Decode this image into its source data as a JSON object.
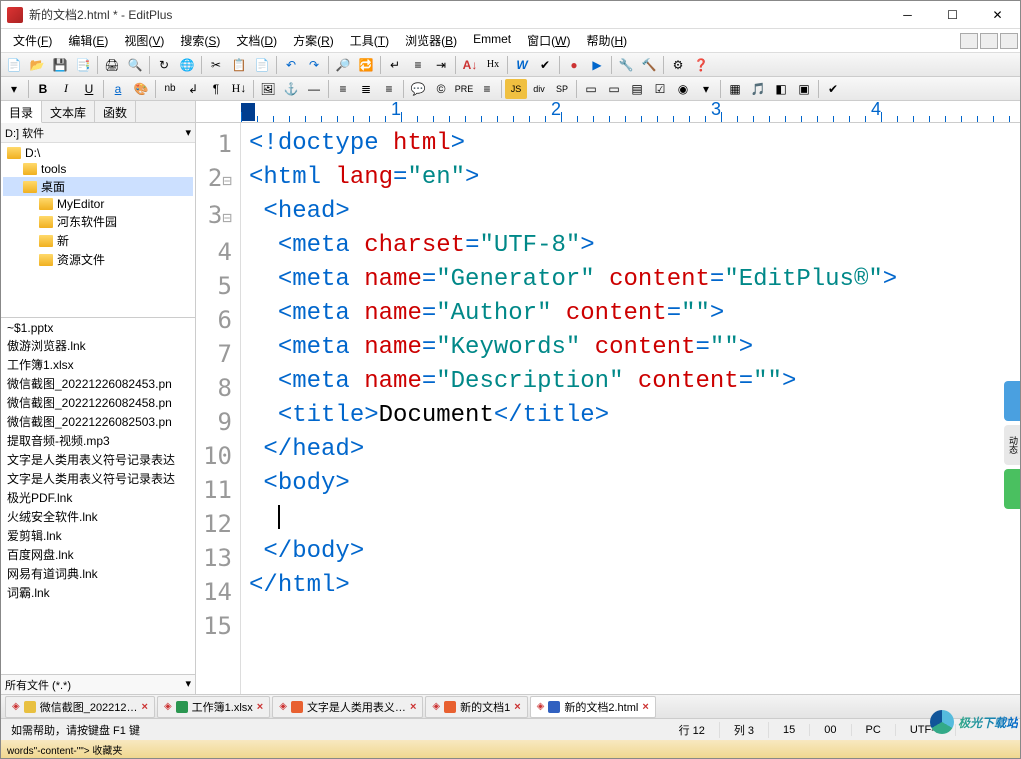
{
  "title": "新的文档2.html * - EditPlus",
  "menus": [
    "文件(F)",
    "编辑(E)",
    "视图(V)",
    "搜索(S)",
    "文档(D)",
    "方案(R)",
    "工具(T)",
    "浏览器(B)",
    "Emmet",
    "窗口(W)",
    "帮助(H)"
  ],
  "sidebar": {
    "tabs": [
      "目录",
      "文本库",
      "函数"
    ],
    "drive": "D:] 软件",
    "tree": [
      {
        "label": "D:\\",
        "indent": 0,
        "sel": false
      },
      {
        "label": "tools",
        "indent": 1,
        "sel": false
      },
      {
        "label": "桌面",
        "indent": 1,
        "sel": true
      },
      {
        "label": "MyEditor",
        "indent": 2,
        "sel": false
      },
      {
        "label": "河东软件园",
        "indent": 2,
        "sel": false
      },
      {
        "label": "新",
        "indent": 2,
        "sel": false
      },
      {
        "label": "资源文件",
        "indent": 2,
        "sel": false
      }
    ],
    "files": [
      "~$1.pptx",
      "傲游浏览器.lnk",
      "工作簿1.xlsx",
      "微信截图_20221226082453.pn",
      "微信截图_20221226082458.pn",
      "微信截图_20221226082503.pn",
      "提取音频-视频.mp3",
      "文字是人类用表义符号记录表达",
      "文字是人类用表义符号记录表达",
      "极光PDF.lnk",
      "火绒安全软件.lnk",
      "爱剪辑.lnk",
      "百度网盘.lnk",
      "网易有道词典.lnk",
      "词霸.lnk"
    ],
    "filter": "所有文件 (*.*)"
  },
  "code_lines": [
    {
      "n": 1,
      "fold": "",
      "html": "<span class='t-punct'>&lt;!</span><span class='t-tag'>doctype</span> <span class='t-attr'>html</span><span class='t-punct'>&gt;</span>"
    },
    {
      "n": 2,
      "fold": "⊟",
      "html": "<span class='t-punct'>&lt;</span><span class='t-tag'>html</span> <span class='t-attr'>lang</span><span class='t-punct'>=</span><span class='t-str'>\"en\"</span><span class='t-punct'>&gt;</span>"
    },
    {
      "n": 3,
      "fold": "⊟",
      "html": " <span class='t-punct'>&lt;</span><span class='t-tag'>head</span><span class='t-punct'>&gt;</span>"
    },
    {
      "n": 4,
      "fold": "",
      "html": "  <span class='t-punct'>&lt;</span><span class='t-tag'>meta</span> <span class='t-attr'>charset</span><span class='t-punct'>=</span><span class='t-str'>\"UTF-8\"</span><span class='t-punct'>&gt;</span>"
    },
    {
      "n": 5,
      "fold": "",
      "html": "  <span class='t-punct'>&lt;</span><span class='t-tag'>meta</span> <span class='t-attr'>name</span><span class='t-punct'>=</span><span class='t-str'>\"Generator\"</span> <span class='t-attr'>content</span><span class='t-punct'>=</span><span class='t-str'>\"EditPlus®\"</span><span class='t-punct'>&gt;</span>"
    },
    {
      "n": 6,
      "fold": "",
      "html": "  <span class='t-punct'>&lt;</span><span class='t-tag'>meta</span> <span class='t-attr'>name</span><span class='t-punct'>=</span><span class='t-str'>\"Author\"</span> <span class='t-attr'>content</span><span class='t-punct'>=</span><span class='t-str'>\"\"</span><span class='t-punct'>&gt;</span>"
    },
    {
      "n": 7,
      "fold": "",
      "html": "  <span class='t-punct'>&lt;</span><span class='t-tag'>meta</span> <span class='t-attr'>name</span><span class='t-punct'>=</span><span class='t-str'>\"Keywords\"</span> <span class='t-attr'>content</span><span class='t-punct'>=</span><span class='t-str'>\"\"</span><span class='t-punct'>&gt;</span>"
    },
    {
      "n": 8,
      "fold": "",
      "html": "  <span class='t-punct'>&lt;</span><span class='t-tag'>meta</span> <span class='t-attr'>name</span><span class='t-punct'>=</span><span class='t-str'>\"Description\"</span> <span class='t-attr'>content</span><span class='t-punct'>=</span><span class='t-str'>\"\"</span><span class='t-punct'>&gt;</span>"
    },
    {
      "n": 9,
      "fold": "",
      "html": "  <span class='t-punct'>&lt;</span><span class='t-tag'>title</span><span class='t-punct'>&gt;</span><span class='t-txt'>Document</span><span class='t-punct'>&lt;/</span><span class='t-tag'>title</span><span class='t-punct'>&gt;</span>"
    },
    {
      "n": 10,
      "fold": "",
      "html": " <span class='t-punct'>&lt;/</span><span class='t-tag'>head</span><span class='t-punct'>&gt;</span>"
    },
    {
      "n": 11,
      "fold": "",
      "html": " <span class='t-punct'>&lt;</span><span class='t-tag'>body</span><span class='t-punct'>&gt;</span>"
    },
    {
      "n": 12,
      "fold": "",
      "html": "  <span class='cursor'></span>"
    },
    {
      "n": 13,
      "fold": "",
      "html": " <span class='t-punct'>&lt;/</span><span class='t-tag'>body</span><span class='t-punct'>&gt;</span>"
    },
    {
      "n": 14,
      "fold": "",
      "html": "<span class='t-punct'>&lt;/</span><span class='t-tag'>html</span><span class='t-punct'>&gt;</span>"
    },
    {
      "n": 15,
      "fold": "",
      "html": ""
    }
  ],
  "ruler_marks": [
    "1",
    "2",
    "3",
    "4"
  ],
  "doc_tabs": [
    {
      "label": "微信截图_202212…",
      "icon": "#e8c040",
      "active": false,
      "close": true
    },
    {
      "label": "工作簿1.xlsx",
      "icon": "#2a9650",
      "active": false,
      "close": true
    },
    {
      "label": "文字是人类用表义…",
      "icon": "#e86030",
      "active": false,
      "close": true
    },
    {
      "label": "新的文档1",
      "icon": "#e86030",
      "active": false,
      "close": true
    },
    {
      "label": "新的文档2.html",
      "icon": "#3060c0",
      "active": true,
      "close": true
    }
  ],
  "status": {
    "help": "如需帮助，请按键盘 F1 键",
    "line": "行 12",
    "col": "列 3",
    "num": "15",
    "ovr": "00",
    "pc": "PC",
    "enc": "UTF-8"
  },
  "bottom": "words\"-content-\"\">       收藏夹",
  "watermark": "极光下载站"
}
